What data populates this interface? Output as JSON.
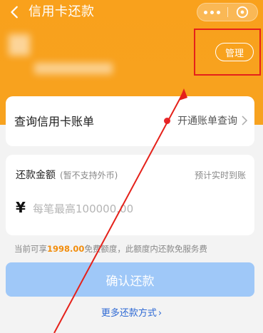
{
  "header": {
    "title": "信用卡还款",
    "manage_label": "管理"
  },
  "query_card": {
    "label": "查询信用卡账单",
    "link_label": "开通账单查询"
  },
  "amount_card": {
    "label": "还款金额",
    "note": "(暂不支持外币)",
    "arrive_label": "预计实时到账",
    "currency_symbol": "¥",
    "input_placeholder": "每笔最高100000.00",
    "input_value": ""
  },
  "limit": {
    "prefix": "当前可享",
    "amount": "1998.00",
    "suffix": "免费额度，此额度内还款免服务费"
  },
  "confirm_label": "确认还款",
  "more_methods_label": "更多还款方式",
  "colors": {
    "header_orange": "#f7a21f",
    "annotation_red": "#e5211a",
    "confirm_disabled": "#9fc8f8",
    "link_blue": "#2f6ad4",
    "highlight_orange": "#f28d0c"
  },
  "icons": [
    "back-arrow-icon",
    "more-dots-icon",
    "close-circle-icon",
    "chevron-right-icon"
  ]
}
